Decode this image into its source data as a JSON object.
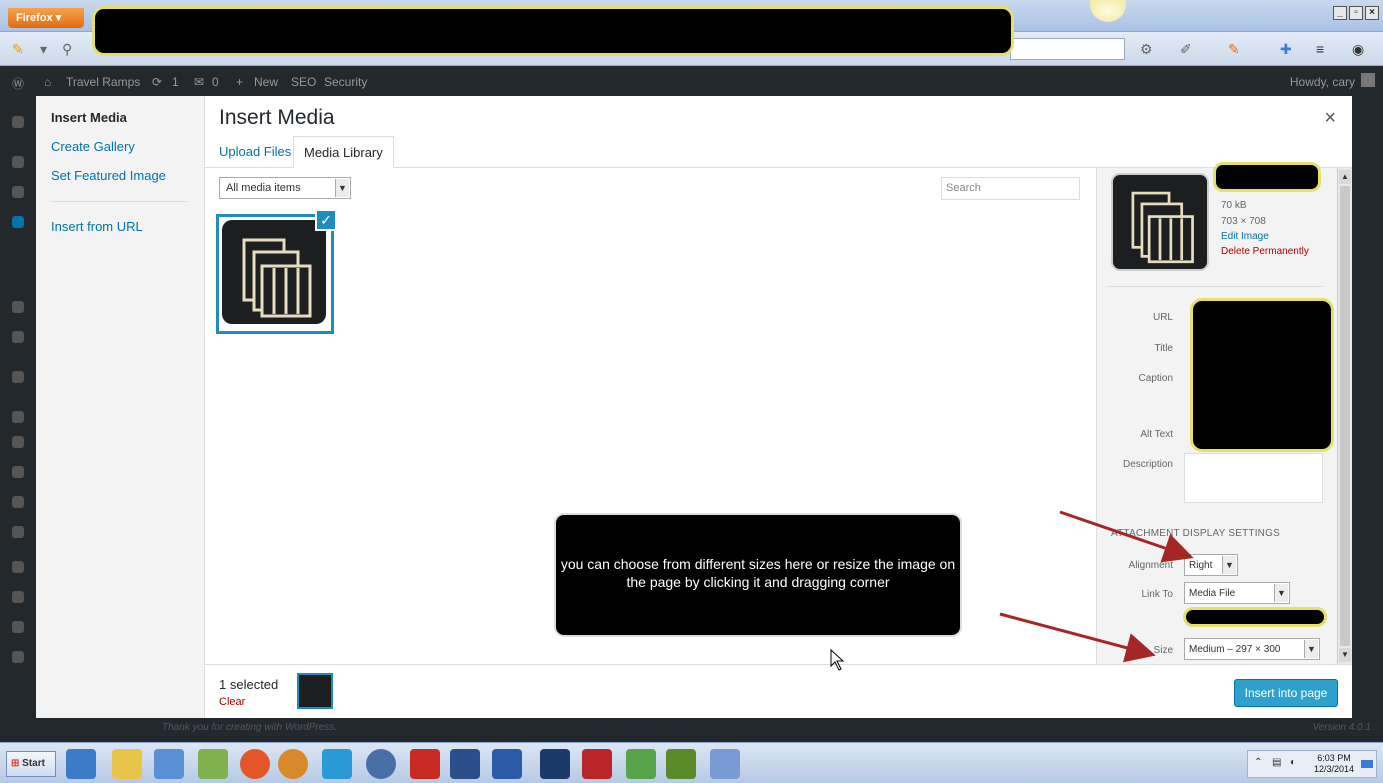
{
  "browser": {
    "menu_label": "Firefox ▾",
    "window_controls": [
      "_",
      "▫",
      "×"
    ]
  },
  "admin_bar": {
    "site_name": "Travel Ramps",
    "updates": "1",
    "comments": "0",
    "new_label": "New",
    "seo_label": "SEO",
    "security_label": "Security",
    "howdy": "Howdy, cary"
  },
  "menu": {
    "items": [
      {
        "label": "Insert Media"
      },
      {
        "label": "Create Gallery"
      },
      {
        "label": "Set Featured Image"
      },
      {
        "label": "Insert from URL"
      }
    ]
  },
  "modal": {
    "title": "Insert Media",
    "close": "×",
    "tabs": [
      {
        "label": "Upload Files"
      },
      {
        "label": "Media Library"
      }
    ],
    "filter_value": "All media items",
    "search_placeholder": "Search"
  },
  "details": {
    "file_size": "70 kB",
    "dimensions": "703 × 708",
    "edit_link": "Edit Image",
    "delete_link": "Delete Permanently",
    "labels": {
      "url": "URL",
      "title": "Title",
      "caption": "Caption",
      "alt_text": "Alt Text",
      "description": "Description"
    },
    "display_settings_title": "ATTACHMENT DISPLAY SETTINGS",
    "alignment_label": "Alignment",
    "alignment_value": "Right",
    "link_to_label": "Link To",
    "link_to_value": "Media File",
    "size_label": "Size",
    "size_value": "Medium – 297 × 300"
  },
  "bottom_toolbar": {
    "selected": "1 selected",
    "clear": "Clear",
    "insert_button": "Insert into page"
  },
  "callout": {
    "text": "you can choose from different sizes here or resize the image on the page by clicking it and dragging corner"
  },
  "footer": {
    "thanks": "Thank you for creating with WordPress.",
    "version": "Version 4.0.1"
  },
  "taskbar": {
    "start_label": "Start",
    "clock_time": "6:03 PM",
    "clock_date": "12/3/2014"
  }
}
